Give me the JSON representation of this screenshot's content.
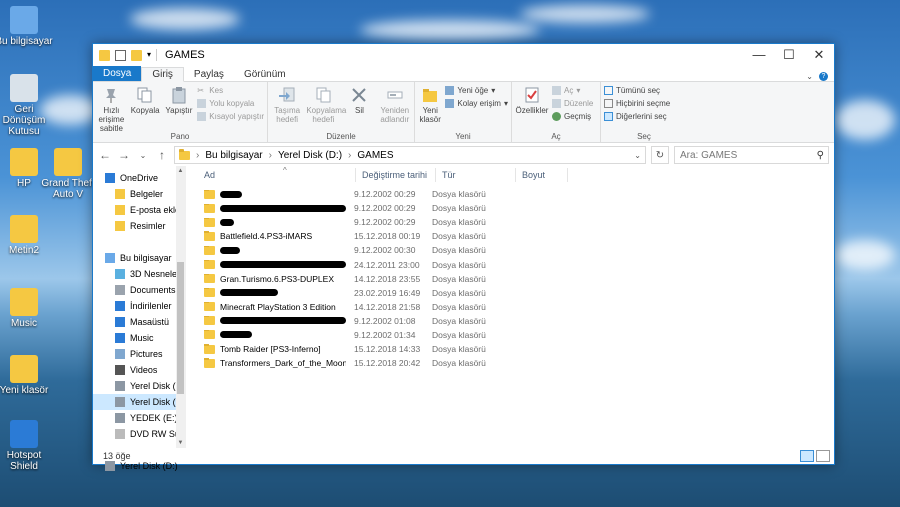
{
  "desktop": {
    "icons": [
      {
        "label": "Bu bilgisayar",
        "icon": "computer-icon"
      },
      {
        "label": "Geri Dönüşüm Kutusu",
        "icon": "recycle-bin-icon"
      },
      {
        "label": "HP",
        "icon": "user-folder-icon"
      },
      {
        "label": "Grand Theft Auto V",
        "icon": "folder-icon"
      },
      {
        "label": "Metin2",
        "icon": "folder-icon"
      },
      {
        "label": "Music",
        "icon": "folder-icon"
      },
      {
        "label": "Yeni klasör",
        "icon": "folder-icon"
      },
      {
        "label": "Hotspot Shield",
        "icon": "shield-app-icon"
      }
    ]
  },
  "window": {
    "title": "GAMES",
    "controls": {
      "minimize": "—",
      "maximize": "☐",
      "close": "✕"
    }
  },
  "tabs": [
    "Dosya",
    "Giriş",
    "Paylaş",
    "Görünüm"
  ],
  "ribbon": {
    "pano": {
      "name": "Pano",
      "pin": "Hızlı erişime sabitle",
      "copy": "Kopyala",
      "paste": "Yapıştır",
      "cut": "Kes",
      "copy_path": "Yolu kopyala",
      "paste_shortcut": "Kısayol yapıştır"
    },
    "duzenle": {
      "name": "Düzenle",
      "move_to": "Taşıma hedefi",
      "copy_to": "Kopyalama hedefi",
      "delete": "Sil",
      "rename": "Yeniden adlandır"
    },
    "yeni": {
      "name": "Yeni",
      "new_folder": "Yeni klasör",
      "new_item": "Yeni öğe",
      "easy_access": "Kolay erişim"
    },
    "ac": {
      "name": "Aç",
      "properties": "Özellikler",
      "open": "Aç",
      "edit": "Düzenle",
      "history": "Geçmiş"
    },
    "sec": {
      "name": "Seç",
      "select_all": "Tümünü seç",
      "select_none": "Hiçbirini seçme",
      "invert": "Diğerlerini seç"
    }
  },
  "address": {
    "crumbs": [
      "Bu bilgisayar",
      "Yerel Disk (D:)",
      "GAMES"
    ],
    "search_placeholder": "Ara: GAMES"
  },
  "nav": [
    {
      "label": "OneDrive",
      "icon": "cloud-icon",
      "indent": 0
    },
    {
      "label": "Belgeler",
      "icon": "folder-icon",
      "indent": 1
    },
    {
      "label": "E-posta ekleri",
      "icon": "folder-icon",
      "indent": 1
    },
    {
      "label": "Resimler",
      "icon": "folder-icon",
      "indent": 1
    },
    {
      "label": "",
      "icon": "",
      "indent": 0
    },
    {
      "label": "Bu bilgisayar",
      "icon": "computer-icon",
      "indent": 0
    },
    {
      "label": "3D Nesneler",
      "icon": "cube-icon",
      "indent": 1
    },
    {
      "label": "Documents",
      "icon": "document-icon",
      "indent": 1
    },
    {
      "label": "İndirilenler",
      "icon": "download-icon",
      "indent": 1
    },
    {
      "label": "Masaüstü",
      "icon": "desktop-icon",
      "indent": 1
    },
    {
      "label": "Music",
      "icon": "music-icon",
      "indent": 1
    },
    {
      "label": "Pictures",
      "icon": "pictures-icon",
      "indent": 1
    },
    {
      "label": "Videos",
      "icon": "video-icon",
      "indent": 1
    },
    {
      "label": "Yerel Disk (C:)",
      "icon": "drive-icon",
      "indent": 1
    },
    {
      "label": "Yerel Disk (D:)",
      "icon": "drive-icon",
      "indent": 1,
      "selected": true
    },
    {
      "label": "YEDEK (E:)",
      "icon": "drive-icon",
      "indent": 1
    },
    {
      "label": "DVD RW Sürücüsü",
      "icon": "dvd-icon",
      "indent": 1
    },
    {
      "label": "",
      "icon": "",
      "indent": 0
    },
    {
      "label": "Yerel Disk (D:)",
      "icon": "drive-icon",
      "indent": 0
    }
  ],
  "columns": [
    "Ad",
    "Değiştirme tarihi",
    "Tür",
    "Boyut"
  ],
  "rows": [
    {
      "name": "",
      "redact": 22,
      "date": "9.12.2002 00:29",
      "type": "Dosya klasörü"
    },
    {
      "name": "",
      "redact": 130,
      "date": "9.12.2002 00:29",
      "type": "Dosya klasörü"
    },
    {
      "name": "",
      "redact": 14,
      "date": "9.12.2002 00:29",
      "type": "Dosya klasörü"
    },
    {
      "name": "Battlefield.4.PS3-iMARS",
      "redact": 0,
      "date": "15.12.2018 00:19",
      "type": "Dosya klasörü"
    },
    {
      "name": "",
      "redact": 20,
      "date": "9.12.2002 00:30",
      "type": "Dosya klasörü"
    },
    {
      "name": "",
      "redact": 132,
      "date": "24.12.2011 23:00",
      "type": "Dosya klasörü"
    },
    {
      "name": "Gran.Turismo.6.PS3-DUPLEX",
      "redact": 0,
      "date": "14.12.2018 23:55",
      "type": "Dosya klasörü"
    },
    {
      "name": "",
      "redact": 58,
      "date": "23.02.2019 16:49",
      "type": "Dosya klasörü"
    },
    {
      "name": "Minecraft PlayStation 3 Edition",
      "redact": 0,
      "date": "14.12.2018 21:58",
      "type": "Dosya klasörü"
    },
    {
      "name": "",
      "redact": 126,
      "date": "9.12.2002 01:08",
      "type": "Dosya klasörü"
    },
    {
      "name": "",
      "redact": 32,
      "date": "9.12.2002 01:34",
      "type": "Dosya klasörü"
    },
    {
      "name": "Tomb Raider [PS3-Inferno]",
      "redact": 0,
      "date": "15.12.2018 14:33",
      "type": "Dosya klasörü"
    },
    {
      "name": "Transformers_Dark_of_the_Moon_EUR_PS...",
      "redact": 0,
      "date": "15.12.2018 20:42",
      "type": "Dosya klasörü"
    }
  ],
  "status": {
    "count": "13 öğe"
  }
}
